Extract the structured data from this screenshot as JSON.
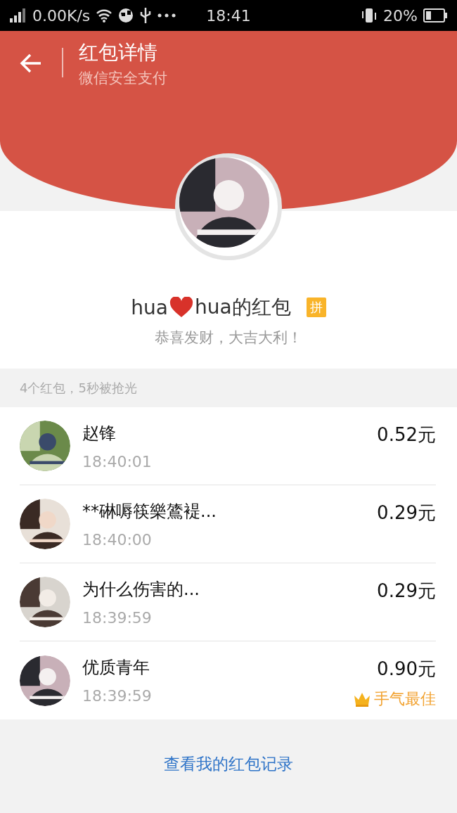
{
  "status_bar": {
    "net_speed": "0.00K/s",
    "time": "18:41",
    "battery": "20%"
  },
  "header": {
    "title": "红包详情",
    "subtitle": "微信安全支付"
  },
  "sender": {
    "name_before": "hua",
    "name_after": "hua的红包",
    "badge": "拼",
    "greeting": "恭喜发财，大吉大利！"
  },
  "summary": "4个红包，5秒被抢光",
  "recipients": [
    {
      "name": "赵锋",
      "time": "18:40:01",
      "amount": "0.52元",
      "best": false
    },
    {
      "name": "**碄嗕筷樂鷟褆...",
      "time": "18:40:00",
      "amount": "0.29元",
      "best": false
    },
    {
      "name": "为什么伤害的...",
      "time": "18:39:59",
      "amount": "0.29元",
      "best": false
    },
    {
      "name": "优质青年",
      "time": "18:39:59",
      "amount": "0.90元",
      "best": true,
      "best_label": "手气最佳"
    }
  ],
  "footer_link": "查看我的红包记录"
}
